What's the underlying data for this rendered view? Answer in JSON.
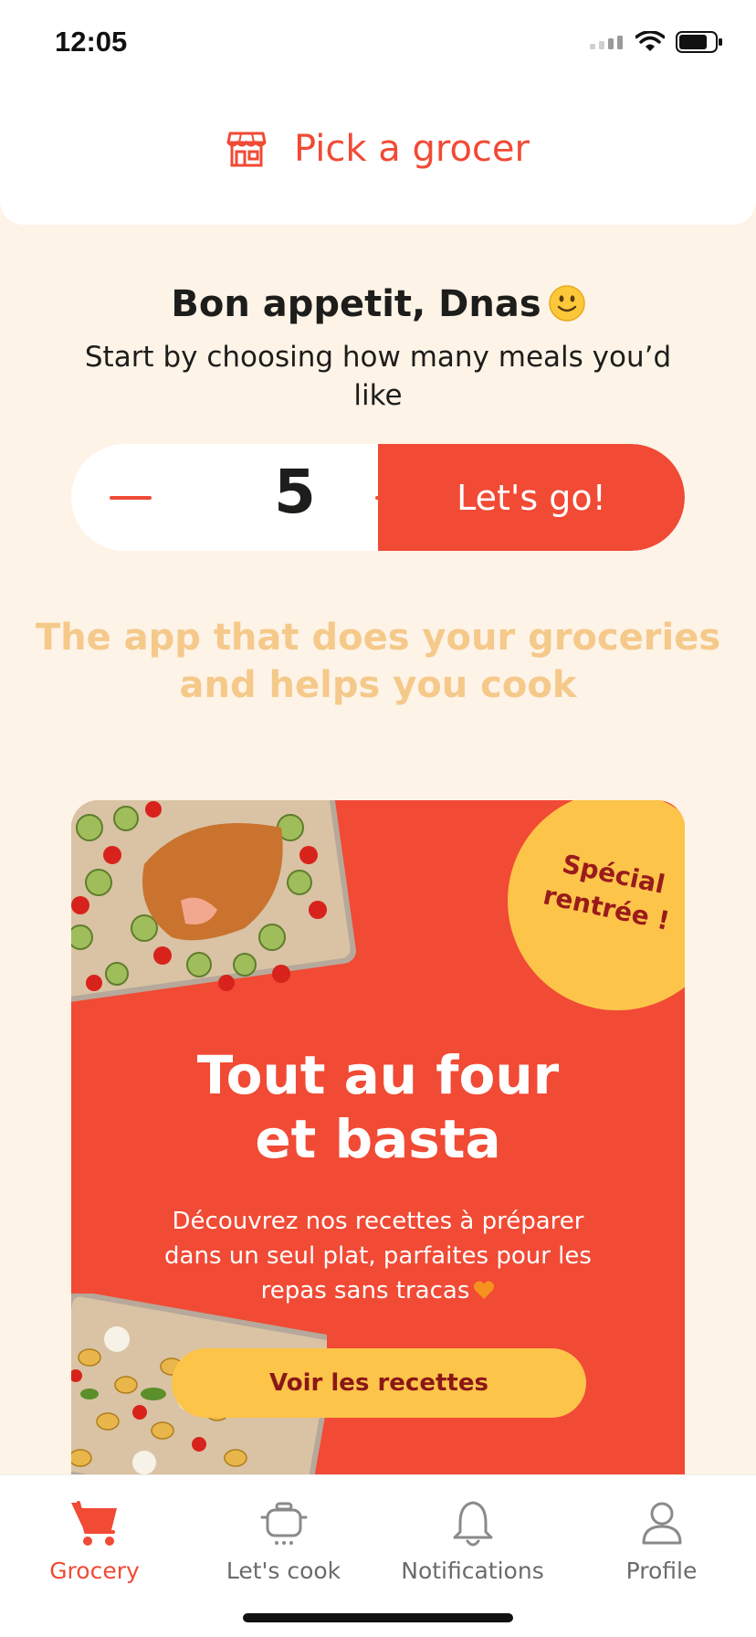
{
  "status_bar": {
    "time": "12:05"
  },
  "header": {
    "grocer_label": "Pick a grocer",
    "store_icon": "store-icon"
  },
  "greeting": {
    "title": "Bon appetit, Dnas",
    "emoji": "slightly-smiling-face",
    "subtitle": "Start by choosing how many meals you’d like"
  },
  "stepper": {
    "value": "5",
    "go_label": "Let's go!"
  },
  "tagline": "The app that does your groceries and helps you cook",
  "promo": {
    "badge": "Spécial rentrée !",
    "title_line1": "Tout au four",
    "title_line2": "et basta",
    "body": "Découvrez nos recettes à préparer dans un seul plat, parfaites pour les repas sans tracas",
    "button": "Voir les recettes"
  },
  "tabs": [
    {
      "label": "Grocery",
      "icon": "cart-icon",
      "active": true
    },
    {
      "label": "Let's cook",
      "icon": "cooking-pot-icon",
      "active": false
    },
    {
      "label": "Notifications",
      "icon": "bell-icon",
      "active": false
    },
    {
      "label": "Profile",
      "icon": "person-icon",
      "active": false
    }
  ],
  "colors": {
    "accent": "#f14a35",
    "background": "#fdf3e7",
    "tagline": "#f5c98a",
    "badge": "#fdc44a"
  }
}
